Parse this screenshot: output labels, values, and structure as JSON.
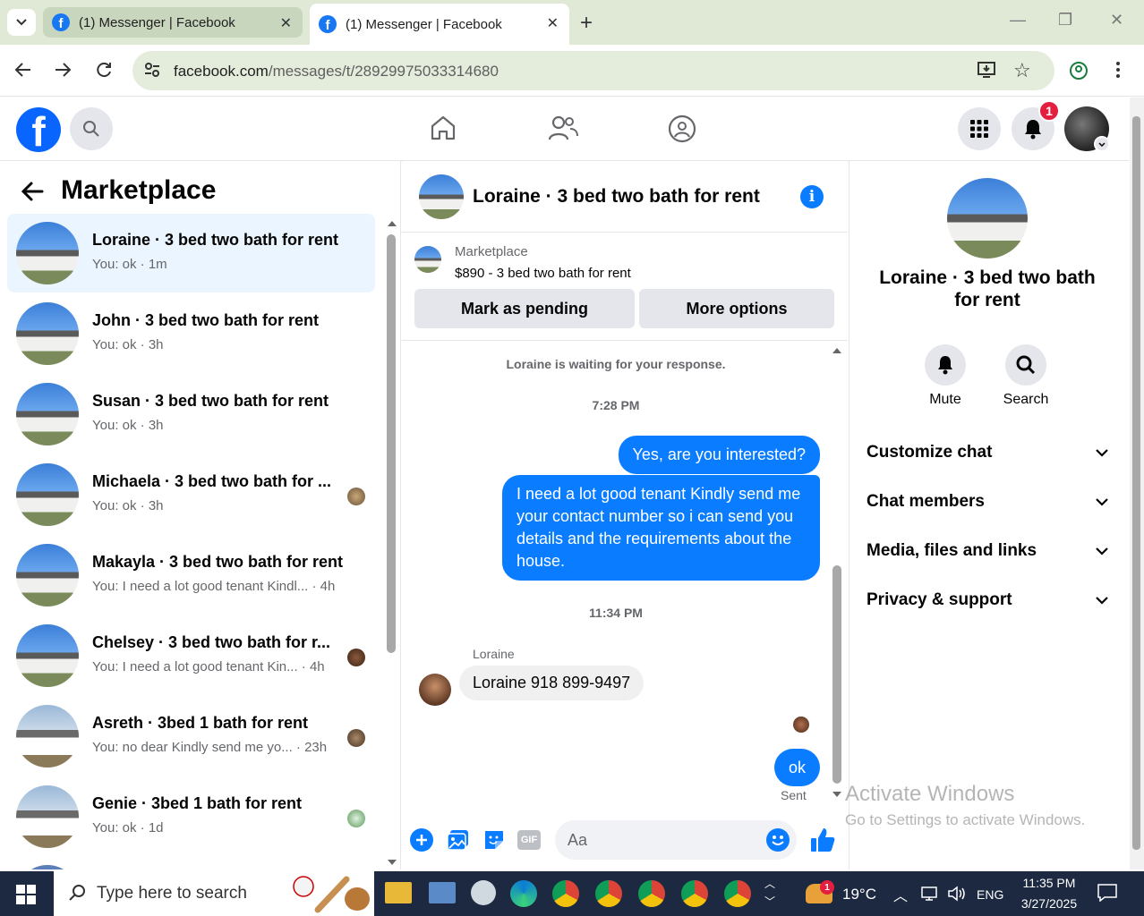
{
  "browser": {
    "tabs": [
      {
        "title": "(1) Messenger | Facebook"
      },
      {
        "title": "(1) Messenger | Facebook"
      }
    ],
    "url_host": "facebook.com",
    "url_path": "/messages/t/28929975033314680"
  },
  "header": {
    "notification_count": "1"
  },
  "sidebar": {
    "title": "Marketplace",
    "conversations": [
      {
        "name": "Loraine · 3 bed two bath for rent",
        "preview": "You: ok · 1m"
      },
      {
        "name": "John · 3 bed two bath for rent",
        "preview": "You: ok · 3h"
      },
      {
        "name": "Susan · 3 bed two bath for rent",
        "preview": "You: ok · 3h"
      },
      {
        "name": "Michaela · 3 bed two bath for ...",
        "preview": "You: ok · 3h"
      },
      {
        "name": "Makayla · 3 bed two bath for rent",
        "preview": "You: I need a lot good tenant Kindl... · 4h"
      },
      {
        "name": "Chelsey · 3 bed two bath for r...",
        "preview": "You: I need a lot good tenant Kin... · 4h"
      },
      {
        "name": "Asreth · 3bed 1 bath for rent",
        "preview": "You: no dear Kindly send me yo... · 23h"
      },
      {
        "name": "Genie · 3bed 1 bath for rent",
        "preview": "You: ok · 1d"
      }
    ]
  },
  "chat": {
    "title": "Loraine · 3 bed two bath for rent",
    "listing_label": "Marketplace",
    "listing_title": "$890 - 3 bed two bath for rent",
    "mark_pending": "Mark as pending",
    "more_options": "More options",
    "waiting_notice": "Loraine is waiting for your response.",
    "time1": "7:28 PM",
    "msg1": "Yes, are you interested?",
    "msg2": "I need a lot good tenant Kindly send me your contact number so i can send you details and the requirements about the house.",
    "time2": "11:34 PM",
    "sender": "Loraine",
    "msg3": "Loraine 918 899-9497",
    "msg4": "ok",
    "sent_status": "Sent",
    "composer_placeholder": "Aa"
  },
  "details": {
    "name": "Loraine · 3 bed two bath for rent",
    "mute_label": "Mute",
    "search_label": "Search",
    "sections": [
      "Customize chat",
      "Chat members",
      "Media, files and links",
      "Privacy & support"
    ]
  },
  "watermark": {
    "line1": "Activate Windows",
    "line2": "Go to Settings to activate Windows."
  },
  "taskbar": {
    "search_placeholder": "Type here to search",
    "weather": "19°C",
    "language": "ENG",
    "time": "11:35 PM",
    "date": "3/27/2025",
    "weather_badge": "1"
  },
  "colors": {
    "messenger_blue": "#0a7cff",
    "facebook_blue": "#0866ff",
    "active_row": "#ebf5ff",
    "chrome_frame": "#dfe9d6"
  }
}
